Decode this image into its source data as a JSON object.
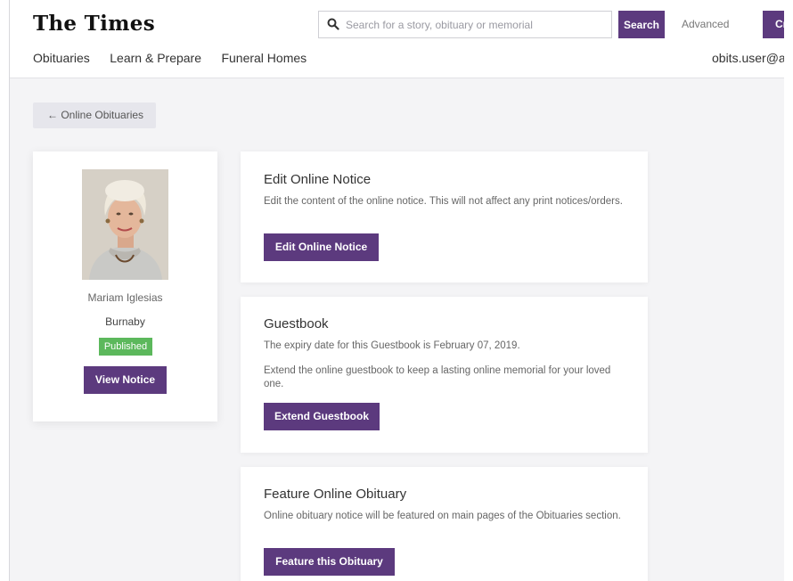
{
  "header": {
    "logo": "The Times",
    "search_placeholder": "Search for a story, obituary or memorial",
    "search_button": "Search",
    "advanced_link": "Advanced",
    "create_button": "Cr",
    "user": "obits.user@a"
  },
  "nav": {
    "items": [
      "Obituaries",
      "Learn & Prepare",
      "Funeral Homes"
    ]
  },
  "back_button": {
    "arrow": "←",
    "label": "Online Obituaries"
  },
  "profile": {
    "name": "Mariam Iglesias",
    "city": "Burnaby",
    "status": "Published",
    "view_button": "View Notice"
  },
  "cards": [
    {
      "title": "Edit Online Notice",
      "text": "Edit the content of the online notice. This will not affect any print notices/orders.",
      "button": "Edit Online Notice"
    },
    {
      "title": "Guestbook",
      "text": "The expiry date for this Guestbook is February 07, 2019.",
      "text2": "Extend the online guestbook to keep a lasting online memorial for your loved one.",
      "button": "Extend Guestbook"
    },
    {
      "title": "Feature Online Obituary",
      "text": "Online obituary notice will be featured on main pages of the Obituaries section.",
      "button": "Feature this Obituary"
    }
  ],
  "colors": {
    "accent": "#5c3a7e",
    "published": "#5cb85c",
    "background": "#f4f4f6"
  }
}
